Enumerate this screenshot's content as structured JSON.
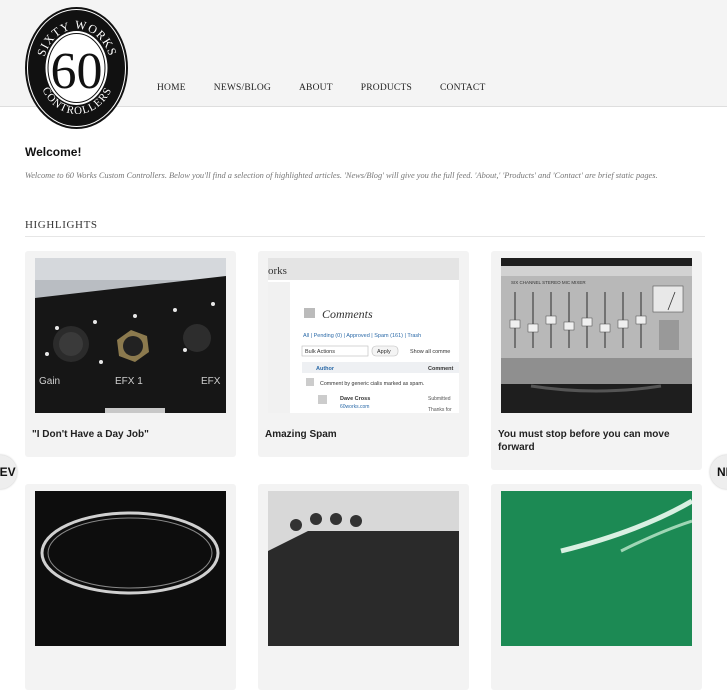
{
  "logo": {
    "top_text": "SIXTY WORKS",
    "number": "60",
    "bottom_text": "CONTROLLERS"
  },
  "nav": [
    "HOME",
    "NEWS/BLOG",
    "ABOUT",
    "PRODUCTS",
    "CONTACT"
  ],
  "welcome": {
    "title": "Welcome!",
    "text": "Welcome to 60 Works Custom Controllers. Below you'll find a selection of highlighted articles. 'News/Blog' will give you the full feed. 'About,' 'Products' and 'Contact' are brief static pages."
  },
  "highlights": {
    "title": "HIGHLIGHTS",
    "cards": [
      {
        "title": "\"I Don't Have a Day Job\"",
        "image": "controller-knobs-photo",
        "labels": [
          "Gain",
          "EFX 1",
          "EFX"
        ]
      },
      {
        "title": "Amazing Spam",
        "image": "wordpress-comments-screenshot",
        "screenshot": {
          "header": "orks",
          "heading": "Comments",
          "filters": "All | Pending (0) | Approved | Spam (161) | Trash",
          "bulk": "Bulk Actions",
          "apply": "Apply",
          "show": "Show all comme",
          "col_author": "Author",
          "col_comment": "Comment",
          "row1": "Comment by generic cialis marked as spam.",
          "row2_name": "Dave Cross",
          "row2_site": "60works.com",
          "row2_status": "Submitted",
          "row2_thanks": "Thanks for"
        }
      },
      {
        "title": "You must stop before you can move forward",
        "image": "vintage-mixer-photo",
        "label": "SIX CHANNEL STEREO MIC MIXER"
      },
      {
        "title": "",
        "image": "sixty-works-logo-plate-photo"
      },
      {
        "title": "",
        "image": "pedal-knobs-photo"
      },
      {
        "title": "",
        "image": "green-sixty-works-photo"
      }
    ]
  },
  "carousel": {
    "prev": "PREV",
    "next": "NEXT"
  }
}
